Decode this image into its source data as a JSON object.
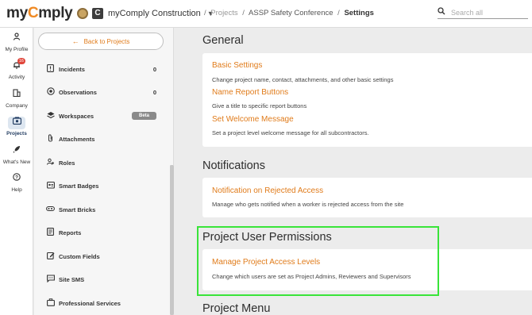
{
  "header": {
    "logo_prefix": "my",
    "logo_accent": "C",
    "logo_suffix": "mply",
    "company_name": "myComply Construction",
    "breadcrumbs": [
      "Projects",
      "ASSP Safety Conference",
      "Settings"
    ],
    "search_placeholder": "Search all"
  },
  "leftnav": [
    {
      "label": "My Profile",
      "icon": "person-icon"
    },
    {
      "label": "Activity",
      "icon": "bell-icon",
      "badge": "16"
    },
    {
      "label": "Company",
      "icon": "building-icon"
    },
    {
      "label": "Projects",
      "icon": "projects-icon",
      "active": true
    },
    {
      "label": "What's New",
      "icon": "rocket-icon"
    },
    {
      "label": "Help",
      "icon": "help-icon"
    }
  ],
  "subnav": {
    "back_label": "Back to Projects",
    "items": [
      {
        "label": "Incidents",
        "count": "0",
        "icon": "incident-icon"
      },
      {
        "label": "Observations",
        "count": "0",
        "icon": "observation-icon"
      },
      {
        "label": "Workspaces",
        "tag": "Beta",
        "icon": "layers-icon"
      },
      {
        "label": "Attachments",
        "icon": "paperclip-icon"
      },
      {
        "label": "Roles",
        "icon": "roles-icon"
      },
      {
        "label": "Smart Badges",
        "icon": "badge-icon"
      },
      {
        "label": "Smart Bricks",
        "icon": "brick-icon"
      },
      {
        "label": "Reports",
        "icon": "report-icon"
      },
      {
        "label": "Custom Fields",
        "icon": "edit-icon"
      },
      {
        "label": "Site SMS",
        "icon": "sms-icon"
      },
      {
        "label": "Professional Services",
        "icon": "briefcase-icon"
      }
    ]
  },
  "main": {
    "general": {
      "title": "General",
      "items": [
        {
          "link": "Basic Settings",
          "desc": "Change project name, contact, attachments, and other basic settings"
        },
        {
          "link": "Name Report Buttons",
          "desc": "Give a title to specific report buttons"
        },
        {
          "link": "Set Welcome Message",
          "desc": "Set a project level welcome message for all subcontractors."
        }
      ]
    },
    "notifications": {
      "title": "Notifications",
      "items": [
        {
          "link": "Notification on Rejected Access",
          "desc": "Manage who gets notified when a worker is rejected access from the site"
        }
      ]
    },
    "permissions": {
      "title": "Project User Permissions",
      "items": [
        {
          "link": "Manage Project Access Levels",
          "desc": "Change which users are set as Project Admins, Reviewers and Supervisors"
        }
      ]
    },
    "menu": {
      "title": "Project Menu"
    }
  },
  "colors": {
    "accent": "#e07b1a",
    "highlight": "#39e439",
    "badge": "#e0453a"
  }
}
